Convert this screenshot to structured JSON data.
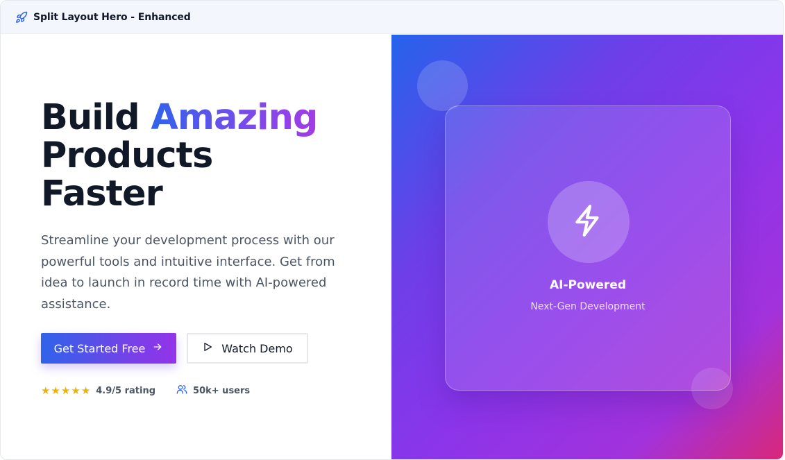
{
  "window": {
    "title": "Split Layout Hero - Enhanced"
  },
  "hero": {
    "headline_1": "Build",
    "headline_highlight": "Amazing",
    "headline_2": "Products",
    "headline_3": "Faster",
    "description": "Streamline your development process with our powerful tools and intuitive interface. Get from idea to launch in record time with AI-powered assistance.",
    "primary_button": "Get Started Free",
    "secondary_button": "Watch Demo",
    "rating": {
      "stars": 5,
      "text": "4.9/5 rating"
    },
    "users_text": "50k+ users"
  },
  "feature_card": {
    "icon": "lightning-icon",
    "title": "AI-Powered",
    "subtitle": "Next-Gen Development"
  },
  "colors": {
    "accent_blue": "#2f63ea",
    "accent_purple": "#9333ea",
    "accent_pink": "#db2777",
    "star": "#eab308",
    "text_dark": "#111827",
    "text_body": "#4b5563"
  }
}
